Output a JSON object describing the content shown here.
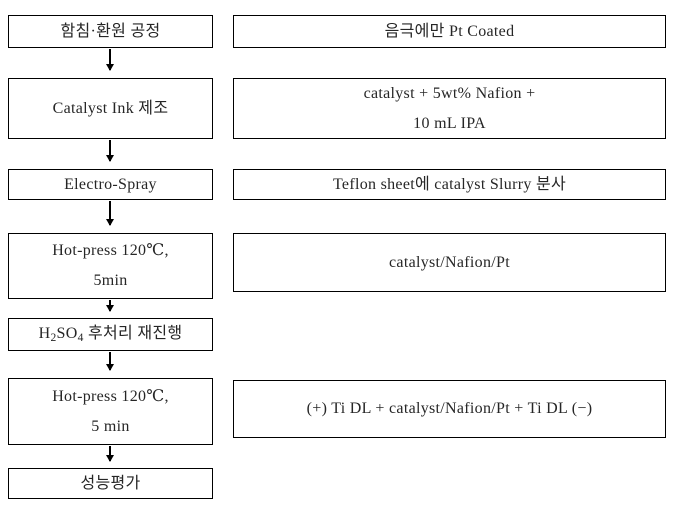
{
  "diagram": {
    "title": "Catalyst Coated Electrode Fabrication Process Flowchart",
    "background_color": "#ffffff",
    "border_color": "#000000",
    "text_color": "#262626"
  },
  "process_steps": [
    {
      "id": "step-1",
      "label": "함침·환원 공정",
      "detail": "음극에만 Pt Coated",
      "detail_lines": [
        "음극에만 Pt Coated"
      ]
    },
    {
      "id": "step-2",
      "label": "Catalyst Ink 제조",
      "detail": "catalyst  + 5wt% Nafion  +  10 mL IPA",
      "detail_lines": [
        "catalyst  + 5wt% Nafion  +",
        "10 mL IPA"
      ]
    },
    {
      "id": "step-3",
      "label": "Electro-Spray",
      "detail": "Teflon sheet에 catalyst Slurry 분사",
      "detail_lines": [
        "Teflon sheet에 catalyst Slurry 분사"
      ]
    },
    {
      "id": "step-4",
      "label": "Hot-press 120℃, 5min",
      "label_lines": [
        "Hot-press 120℃,",
        "5min"
      ],
      "detail": "catalyst/Nafion/Pt",
      "detail_lines": [
        "catalyst/Nafion/Pt"
      ]
    },
    {
      "id": "step-5",
      "label": "H2SO4 후처리 재진행",
      "label_html_parts": [
        "H",
        "2",
        "SO",
        "4",
        " 후처리 재진행"
      ],
      "detail": null
    },
    {
      "id": "step-6",
      "label": "Hot-press 120℃, 5 min",
      "label_lines": [
        "Hot-press 120℃,",
        "5 min"
      ],
      "detail": "(+) Ti DL +  catalyst/Nafion/Pt + Ti DL (-)",
      "detail_lines": [
        "(+) Ti DL +  catalyst/Nafion/Pt + Ti DL (−)"
      ]
    },
    {
      "id": "step-7",
      "label": "성능평가",
      "detail": null
    }
  ],
  "left_column": {
    "box1": "함침·환원 공정",
    "box2": "Catalyst Ink 제조",
    "box3": "Electro-Spray",
    "box4_line1": "Hot-press 120℃,",
    "box4_line2": "5min",
    "box5_prefix": "H",
    "box5_sub1": "2",
    "box5_mid": "SO",
    "box5_sub2": "4",
    "box5_suffix": " 후처리 재진행",
    "box6_line1": "Hot-press 120℃,",
    "box6_line2": "5 min",
    "box7": "성능평가"
  },
  "right_column": {
    "box1": "음극에만 Pt Coated",
    "box2_line1": "catalyst  + 5wt% Nafion  +",
    "box2_line2": "10 mL IPA",
    "box3": "Teflon sheet에 catalyst Slurry 분사",
    "box4": "catalyst/Nafion/Pt",
    "box6": "(+) Ti DL +  catalyst/Nafion/Pt + Ti DL (−)"
  },
  "arrows": {
    "count": 6,
    "direction": "down",
    "glyph": "↓"
  }
}
